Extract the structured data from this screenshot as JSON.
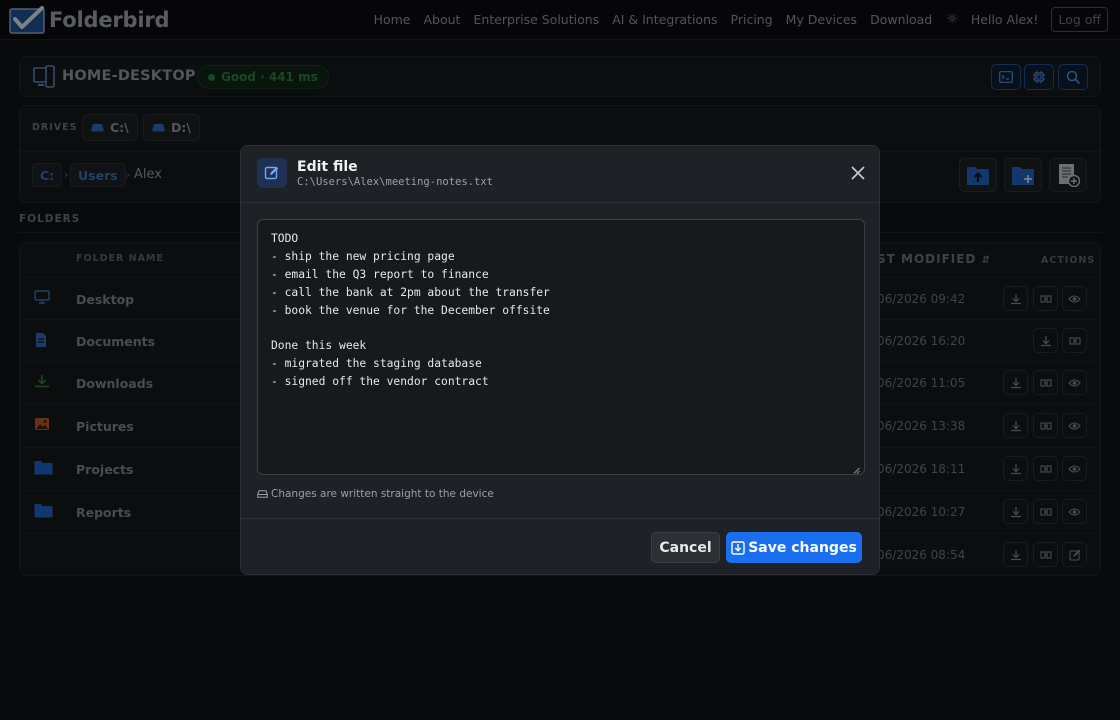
{
  "app": {
    "brand": "Folderbird",
    "nav": [
      "Home",
      "About",
      "Enterprise Solutions",
      "AI & Integrations",
      "Pricing",
      "My Devices",
      "Download"
    ],
    "theme_icon": "sun-icon",
    "greeting": "Hello Alex!",
    "logoff": "Log off"
  },
  "device": {
    "name": "HOME-DESKTOP",
    "status": "Good · 441 ms",
    "tools": [
      "terminal-icon",
      "chip-icon",
      "search-icon"
    ]
  },
  "drives": {
    "label": "DRIVES",
    "items": [
      "C:\\",
      "D:\\"
    ]
  },
  "breadcrumb": {
    "root": "C:",
    "parent": "Users",
    "current": "Alex"
  },
  "folders": {
    "section_label": "FOLDERS",
    "col_name": "FOLDER NAME",
    "col_modified": "ST MODIFIED",
    "col_actions": "ACTIONS",
    "rows": [
      {
        "name": "Desktop",
        "modified": "06/2026 09:42",
        "icon": "monitor-icon",
        "actions": [
          "download-icon",
          "share-icon",
          "view-icon"
        ]
      },
      {
        "name": "Documents",
        "modified": "06/2026 16:20",
        "icon": "document-icon",
        "actions": [
          "download-icon",
          "share-icon"
        ]
      },
      {
        "name": "Downloads",
        "modified": "06/2026 11:05",
        "icon": "download-icon",
        "actions": [
          "download-icon",
          "share-icon",
          "view-icon"
        ]
      },
      {
        "name": "Pictures",
        "modified": "06/2026 13:38",
        "icon": "image-icon",
        "actions": [
          "download-icon",
          "share-icon",
          "view-icon"
        ]
      },
      {
        "name": "Projects",
        "modified": "06/2026 18:11",
        "icon": "folder-icon",
        "actions": [
          "download-icon",
          "share-icon",
          "view-icon"
        ]
      },
      {
        "name": "Reports",
        "modified": "06/2026 10:27",
        "icon": "folder-icon",
        "actions": [
          "download-icon",
          "share-icon",
          "view-icon"
        ]
      },
      {
        "name": "",
        "modified": "06/2026 08:54",
        "icon": "",
        "actions": [
          "download-icon",
          "share-icon",
          "edit-icon"
        ]
      }
    ]
  },
  "modal": {
    "title": "Edit file",
    "path": "C:\\Users\\Alex\\meeting-notes.txt",
    "content": "TODO\n- ship the new pricing page\n- email the Q3 report to finance\n- call the bank at 2pm about the transfer\n- book the venue for the December offsite\n\nDone this week\n- migrated the staging database\n- signed off the vendor contract",
    "note": "Changes are written straight to the device",
    "cancel": "Cancel",
    "save": "Save changes"
  },
  "colors": {
    "accent": "#1a6ff0",
    "status_good": "#2a7d43",
    "background": "#101214"
  }
}
